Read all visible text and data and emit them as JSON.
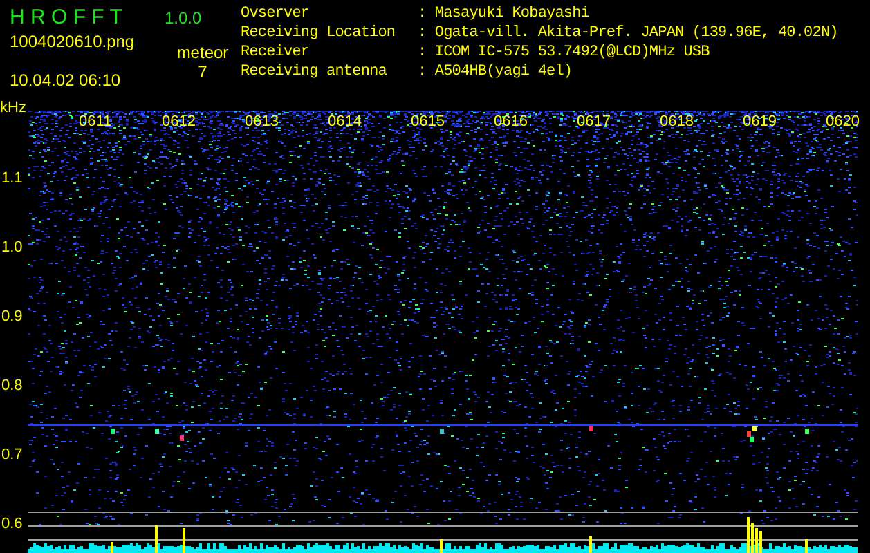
{
  "app": {
    "title": "H R O F F T",
    "version": "1.0.0"
  },
  "file": "1004020610.png",
  "datetime": "10.04.02 06:10",
  "meteor": {
    "label": "meteor",
    "count": "7"
  },
  "info": [
    {
      "label": "Ovserver",
      "value": ": Masayuki Kobayashi"
    },
    {
      "label": "Receiving Location",
      "value": ": Ogata-vill. Akita-Pref. JAPAN (139.96E, 40.02N)"
    },
    {
      "label": "Receiver",
      "value": ": ICOM IC-575 53.7492(@LCD)MHz USB"
    },
    {
      "label": "Receiving antenna",
      "value": ": A504HB(yagi 4el)"
    }
  ],
  "plot": {
    "unit": "kHz",
    "freq_labels": [
      "1.1",
      "1.0",
      "0.9",
      "0.8",
      "0.7",
      "0.6"
    ],
    "time_labels": [
      "0611",
      "0612",
      "0613",
      "0614",
      "0615",
      "0616",
      "0617",
      "0618",
      "0619",
      "0620"
    ]
  }
}
